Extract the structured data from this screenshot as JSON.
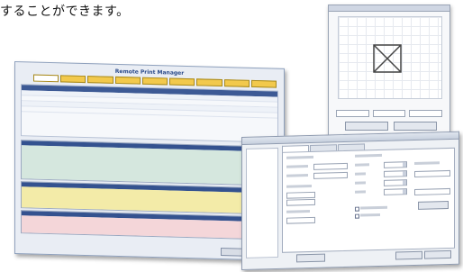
{
  "caption": "することができます。",
  "manager": {
    "title": "Remote Print Manager",
    "tabs": [
      "",
      "",
      "",
      "",
      "",
      "",
      "",
      "",
      ""
    ],
    "table_headers": [
      "",
      "",
      "",
      "",
      "",
      "",
      ""
    ],
    "rows": 4,
    "sections": [
      {
        "color": "#d5e7de"
      },
      {
        "color": "#f3eba8"
      },
      {
        "color": "#f4d6d9"
      }
    ],
    "status": "",
    "footer_button": ""
  },
  "preview": {
    "label": "",
    "fields": [
      "",
      "",
      ""
    ],
    "buttons": [
      "",
      ""
    ]
  },
  "dialog": {
    "title": "",
    "tree": [
      "",
      "",
      ""
    ],
    "tabs": [
      "",
      "",
      ""
    ],
    "buttons": [
      "",
      "",
      "",
      ""
    ]
  },
  "colors": {
    "accent": "#3d5a95",
    "tab_yellow": "#f2c94c"
  }
}
